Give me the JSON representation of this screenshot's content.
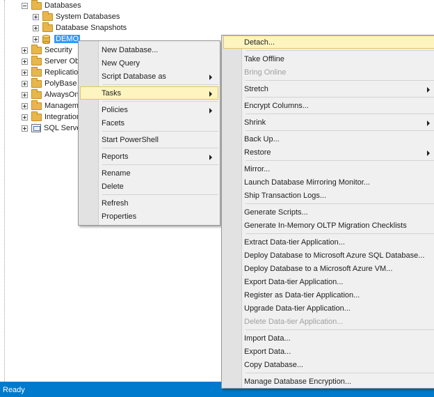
{
  "tree": {
    "databases": "Databases",
    "system_databases": "System Databases",
    "database_snapshots": "Database Snapshots",
    "demo": "DEMO",
    "security": "Security",
    "server_objects": "Server Obje",
    "replication": "Replication",
    "polybase": "PolyBase",
    "alwayson": "AlwaysOn",
    "management": "Manageme",
    "integration": "Integration",
    "sql_server_agent": "SQL Server"
  },
  "status": {
    "text": "Ready"
  },
  "context_menu": {
    "new_database": "New Database...",
    "new_query": "New Query",
    "script_database_as": "Script Database as",
    "tasks": "Tasks",
    "policies": "Policies",
    "facets": "Facets",
    "start_powershell": "Start PowerShell",
    "reports": "Reports",
    "rename": "Rename",
    "delete": "Delete",
    "refresh": "Refresh",
    "properties": "Properties"
  },
  "tasks_menu": {
    "detach": "Detach...",
    "take_offline": "Take Offline",
    "bring_online": "Bring Online",
    "stretch": "Stretch",
    "encrypt_columns": "Encrypt Columns...",
    "shrink": "Shrink",
    "back_up": "Back Up...",
    "restore": "Restore",
    "mirror": "Mirror...",
    "launch_mirroring_monitor": "Launch Database Mirroring Monitor...",
    "ship_transaction_logs": "Ship Transaction Logs...",
    "generate_scripts": "Generate Scripts...",
    "generate_oltp_checklists": "Generate In-Memory OLTP Migration Checklists",
    "extract_data_tier": "Extract Data-tier Application...",
    "deploy_azure_sql": "Deploy Database to Microsoft Azure SQL Database...",
    "deploy_azure_vm": "Deploy Database to a Microsoft Azure VM...",
    "export_data_tier": "Export Data-tier Application...",
    "register_data_tier": "Register as Data-tier Application...",
    "upgrade_data_tier": "Upgrade Data-tier Application...",
    "delete_data_tier": "Delete Data-tier Application...",
    "import_data": "Import Data...",
    "export_data": "Export Data...",
    "copy_database": "Copy Database...",
    "manage_encryption": "Manage Database Encryption..."
  },
  "colors": {
    "status_bar": "#007acc",
    "selection": "#3399ff",
    "menu_highlight": "#fdf4bf",
    "menu_highlight_border": "#e5c365"
  }
}
